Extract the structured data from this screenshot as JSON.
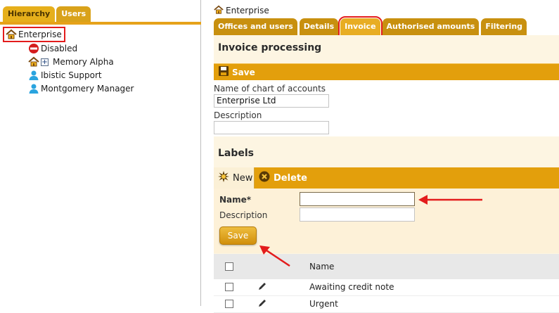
{
  "left": {
    "tabs": [
      {
        "label": "Hierarchy",
        "active": true
      },
      {
        "label": "Users",
        "active": false
      }
    ],
    "tree": {
      "root": "Enterprise",
      "children": [
        {
          "label": "Disabled",
          "icon": "no-entry-icon"
        },
        {
          "label": "Memory Alpha",
          "icon": "home-icon",
          "expandable": true,
          "expander": "+"
        },
        {
          "label": "Ibistic Support",
          "icon": "user-icon"
        },
        {
          "label": "Montgomery Manager",
          "icon": "user-icon"
        }
      ]
    }
  },
  "right": {
    "breadcrumb": "Enterprise",
    "tabs": [
      {
        "label": "Offices and users"
      },
      {
        "label": "Details"
      },
      {
        "label": "Invoice",
        "active": true
      },
      {
        "label": "Authorised amounts"
      },
      {
        "label": "Filtering"
      }
    ],
    "invoice_section": {
      "title": "Invoice processing",
      "save_label": "Save",
      "chart_label": "Name of chart of accounts",
      "chart_value": "Enterprise Ltd",
      "description_label": "Description",
      "description_value": ""
    },
    "labels_section": {
      "title": "Labels",
      "new_label": "New",
      "delete_label": "Delete",
      "name_label": "Name*",
      "name_value": "",
      "description_label": "Description",
      "description_value": "",
      "save_label": "Save"
    },
    "grid": {
      "column_name": "Name",
      "rows": [
        "Awaiting credit note",
        "Urgent"
      ]
    }
  },
  "colors": {
    "accent": "#e39f0c",
    "tab": "#c8900f",
    "highlight": "#e31c1c",
    "panel_bg": "#fdf5e2"
  }
}
